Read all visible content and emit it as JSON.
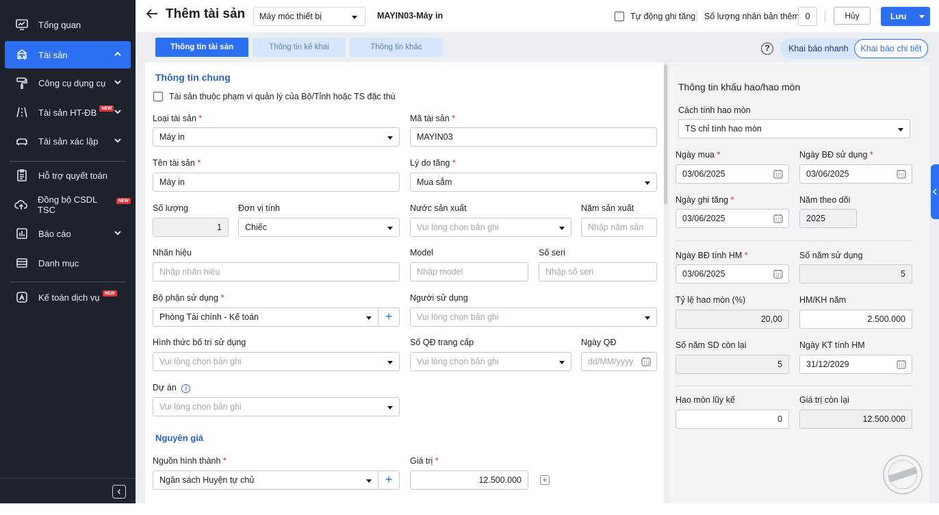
{
  "sidebar": {
    "items": [
      {
        "label": "Tổng quan",
        "icon": "dashboard-icon"
      },
      {
        "label": "Tài sản",
        "icon": "car-building-icon"
      },
      {
        "label": "Công cụ dụng cụ",
        "icon": "paint-roller-icon"
      },
      {
        "label": "Tài sản HT-ĐB",
        "icon": "road-icon",
        "badge": "NEW"
      },
      {
        "label": "Tài sản xác lập",
        "icon": "car-icon"
      },
      {
        "label": "Hỗ trợ quyết toán",
        "icon": "clipboard-icon"
      },
      {
        "label": "Đồng bộ CSDL TSC",
        "icon": "cloud-upload-icon",
        "badge": "NEW"
      },
      {
        "label": "Báo cáo",
        "icon": "bar-chart-icon"
      },
      {
        "label": "Danh mục",
        "icon": "list-icon"
      },
      {
        "label": "Kế toán dịch vụ",
        "icon": "accounting-icon",
        "badge": "NEW"
      }
    ]
  },
  "header": {
    "title": "Thêm tài sản",
    "category_select": "Máy móc thiết bị",
    "asset_code_name": "MAYIN03-Máy in",
    "auto_increase_label": "Tự động ghi tăng",
    "copies_label": "Số lượng nhân bản thêm",
    "copies_value": "0",
    "cancel_label": "Hủy",
    "save_label": "Lưu"
  },
  "tabs": [
    "Thông tin tài sản",
    "Thông tin kê khai",
    "Thông tin khác"
  ],
  "mode": {
    "quick": "Khai báo nhanh",
    "detail": "Khai báo chi tiết"
  },
  "general": {
    "section_title": "Thông tin chung",
    "special_checkbox_label": "Tài sản thuộc phạm vi quản lý của Bộ/Tỉnh hoặc TS đặc thù",
    "asset_type_label": "Loại tài sản",
    "asset_type_value": "Máy in",
    "asset_code_label": "Mã tài sản",
    "asset_code_value": "MAYIN03",
    "asset_name_label": "Tên tài sản",
    "asset_name_value": "Máy in",
    "reason_label": "Lý do tăng",
    "reason_value": "Mua sắm",
    "quantity_label": "Số lượng",
    "quantity_value": "1",
    "unit_label": "Đơn vị tính",
    "unit_value": "Chiếc",
    "country_label": "Nước sản xuất",
    "country_placeholder": "Vui lòng chọn bản ghi",
    "year_label": "Năm sản xuất",
    "year_placeholder": "Nhập năm sản",
    "brand_label": "Nhãn hiệu",
    "brand_placeholder": "Nhập nhãn hiệu",
    "model_label": "Model",
    "model_placeholder": "Nhập model",
    "serial_label": "Số seri",
    "serial_placeholder": "Nhập số seri",
    "dept_label": "Bộ phận sử dụng",
    "dept_value": "Phòng Tài chính - Kế toán",
    "user_label": "Người sử dụng",
    "user_placeholder": "Vui lòng chọn bản ghi",
    "arrangement_label": "Hình thức bố trí sử dụng",
    "arrangement_placeholder": "Vui lòng chọn bản ghi",
    "decision_label": "Số QĐ trang cấp",
    "decision_placeholder": "Vui lòng chọn bản ghi",
    "decision_date_label": "Ngày QĐ",
    "decision_date_placeholder": "dd/MM/yyyy",
    "project_label": "Dự án",
    "project_placeholder": "Vui lòng chọn bản ghi"
  },
  "cost": {
    "section_title": "Nguyên giá",
    "source_label": "Nguồn hình thành",
    "source_value": "Ngân sách Huyện tự chủ",
    "value_label": "Giá trị",
    "value_value": "12.500.000"
  },
  "depreciation": {
    "section_title": "Thông tin khấu hao/hao mòn",
    "method_label": "Cách tính hao mòn",
    "method_value": "TS chỉ tính hao mòn",
    "buy_date_label": "Ngày mua",
    "buy_date_value": "03/06/2025",
    "use_date_label": "Ngày BĐ sử dụng",
    "use_date_value": "03/06/2025",
    "increase_date_label": "Ngày ghi tăng",
    "increase_date_value": "03/06/2025",
    "track_year_label": "Năm theo dõi",
    "track_year_value": "2025",
    "hm_start_label": "Ngày BĐ tính HM",
    "hm_start_value": "03/06/2025",
    "years_use_label": "Số năm sử dụng",
    "years_use_value": "5",
    "rate_label": "Tỷ lệ hao mòn (%)",
    "rate_value": "20,00",
    "annual_label": "HM/KH năm",
    "annual_value": "2.500.000",
    "remain_years_label": "Số năm SD còn lại",
    "remain_years_value": "5",
    "end_date_label": "Ngày KT tính HM",
    "end_date_value": "31/12/2029",
    "accum_label": "Hao mòn lũy kế",
    "accum_value": "0",
    "remain_value_label": "Giá trị còn lại",
    "remain_value_value": "12.500.000"
  }
}
